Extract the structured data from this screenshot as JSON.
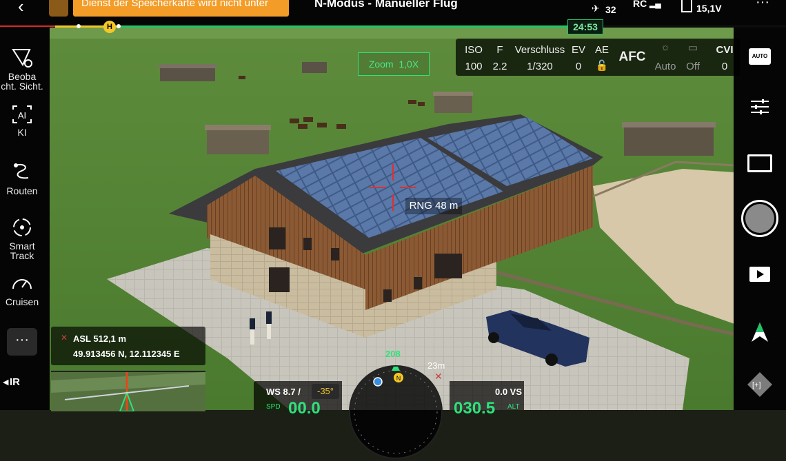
{
  "topbar": {
    "back_icon": "chevron-left-icon",
    "sd_warning": "Dienst der Speicherkarte wird nicht unter",
    "mode_title": "N-Modus - Manueller Flug",
    "satellites": "32",
    "rc_label": "RC",
    "battery_voltage": "15,1V"
  },
  "flight_timer": "24:53",
  "home_marker": "H",
  "zoom_label": "Zoom  1,0X",
  "camera": {
    "headers": [
      "ISO",
      "F",
      "Verschluss",
      "EV",
      "AE"
    ],
    "values": [
      "100",
      "2.2",
      "1/320",
      "0",
      ""
    ],
    "focus_mode": "AFC",
    "wb_label": "Auto",
    "off_label": "Off",
    "cvi_label": "CVI",
    "cvi_value": "0"
  },
  "rangefinder": "RNG 48 m",
  "left_sidebar": {
    "items": [
      {
        "label": "Beoba\ncht. Sicht.",
        "icon": "obstacle-view-icon"
      },
      {
        "label": "KI",
        "icon": "ai-icon"
      },
      {
        "label": "Routen",
        "icon": "routes-icon"
      },
      {
        "label": "Smart\nTrack",
        "icon": "smart-track-icon"
      },
      {
        "label": "Cruisen",
        "icon": "cruise-icon"
      }
    ],
    "more_icon": "more-icon",
    "ir_label": "IR"
  },
  "position": {
    "asl": "ASL 512,1 m",
    "coords": "49.913456 N, 12.112345 E"
  },
  "telemetry": {
    "wind": "WS 8.7 /",
    "pitch": "-35°",
    "speed_label": "SPD",
    "speed_value": "00.0",
    "heading": "208",
    "distance": "23m",
    "vs": "0.0 VS",
    "alt_value": "030.5",
    "alt_label": "ALT"
  },
  "right_sidebar": {
    "icons": [
      "auto-mode-icon",
      "settings-sliders-icon",
      "aspect-frame-icon",
      "shutter-button",
      "playback-icon",
      "nav-arrow-icon",
      "zoom-move-icon"
    ],
    "auto_label": "AUTO"
  },
  "colors": {
    "accent_orange": "#f39c27",
    "accent_green": "#23c36a",
    "track_red": "#d82727",
    "crosshair_red": "#e03030"
  }
}
